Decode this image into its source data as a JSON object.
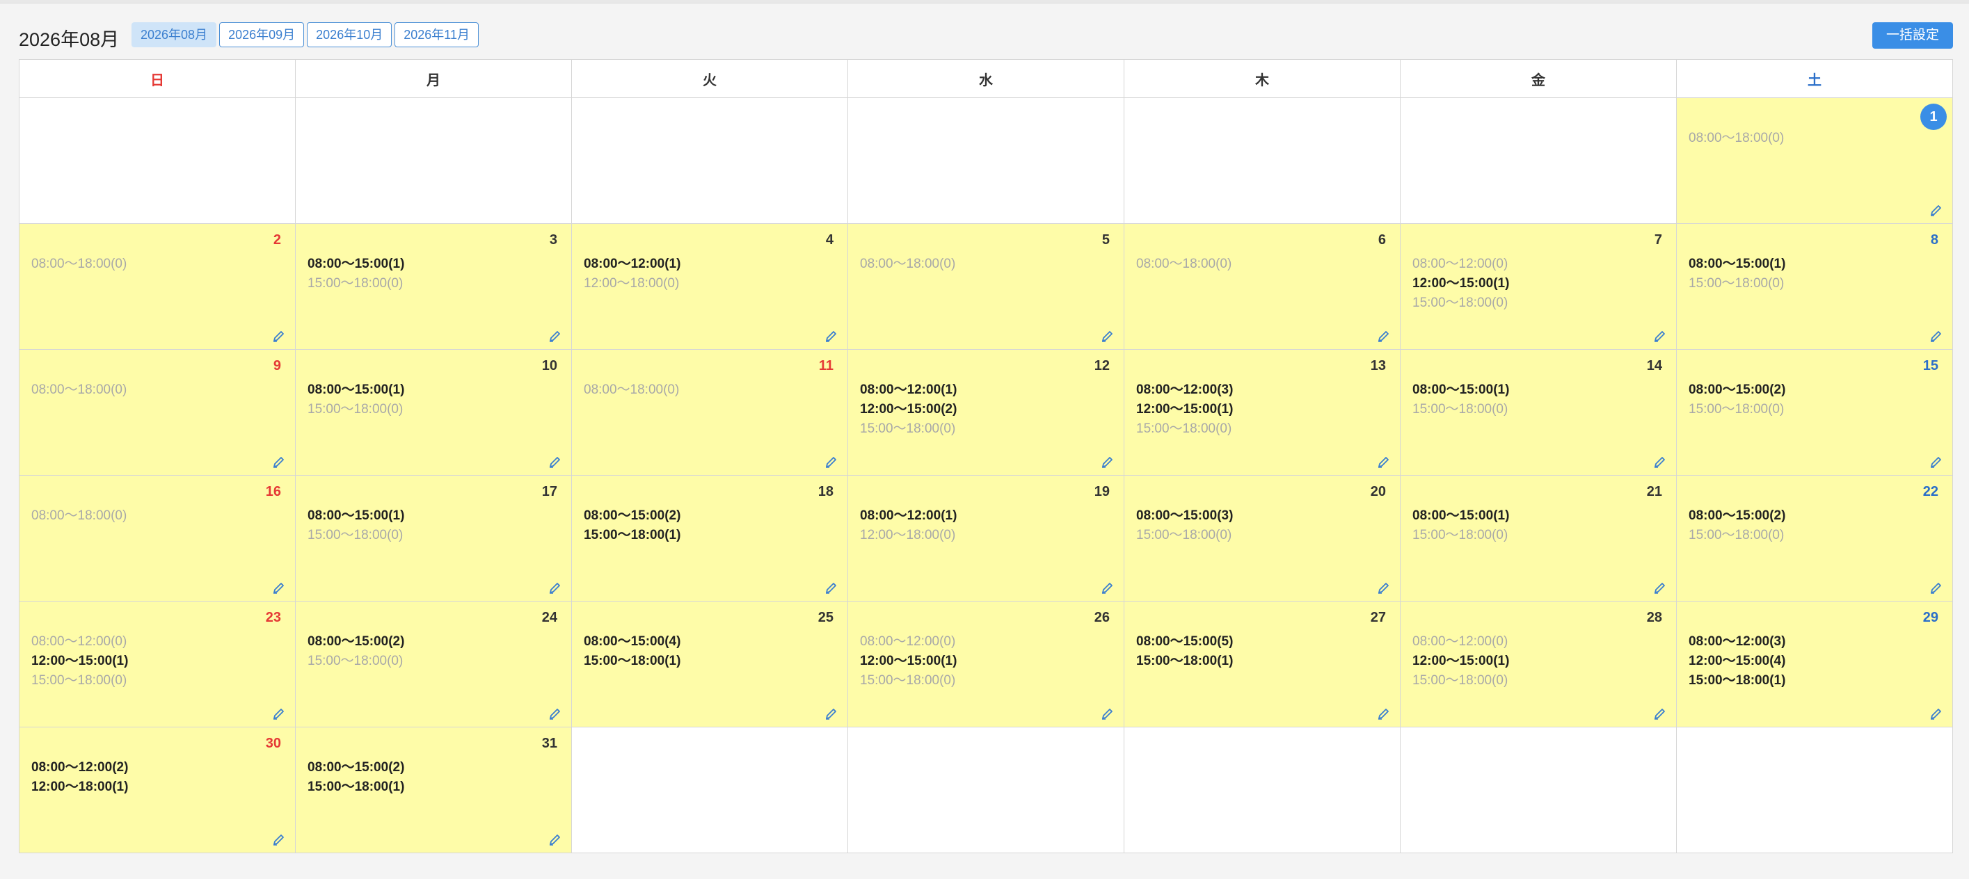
{
  "header": {
    "title": "2026年08月",
    "tabs": [
      "2026年08月",
      "2026年09月",
      "2026年10月",
      "2026年11月"
    ],
    "active_tab": 0,
    "bulk_button": "一括設定"
  },
  "weekdays": [
    "日",
    "月",
    "火",
    "水",
    "木",
    "金",
    "土"
  ],
  "colors": {
    "accent": "#3a8ee6",
    "sunday": "#e53935",
    "saturday": "#2b6fc9",
    "active_cell": "#fefca8",
    "inactive_slot": "#a8a8a8"
  },
  "cells": [
    null,
    null,
    null,
    null,
    null,
    null,
    {
      "day": "1",
      "today": true,
      "slots": [
        {
          "text": "08:00〜18:00(0)",
          "full": false
        }
      ]
    },
    {
      "day": "2",
      "slots": [
        {
          "text": "08:00〜18:00(0)",
          "full": false
        }
      ]
    },
    {
      "day": "3",
      "slots": [
        {
          "text": "08:00〜15:00(1)",
          "full": true
        },
        {
          "text": "15:00〜18:00(0)",
          "full": false
        }
      ]
    },
    {
      "day": "4",
      "slots": [
        {
          "text": "08:00〜12:00(1)",
          "full": true
        },
        {
          "text": "12:00〜18:00(0)",
          "full": false
        }
      ]
    },
    {
      "day": "5",
      "slots": [
        {
          "text": "08:00〜18:00(0)",
          "full": false
        }
      ]
    },
    {
      "day": "6",
      "slots": [
        {
          "text": "08:00〜18:00(0)",
          "full": false
        }
      ]
    },
    {
      "day": "7",
      "slots": [
        {
          "text": "08:00〜12:00(0)",
          "full": false
        },
        {
          "text": "12:00〜15:00(1)",
          "full": true
        },
        {
          "text": "15:00〜18:00(0)",
          "full": false
        }
      ]
    },
    {
      "day": "8",
      "slots": [
        {
          "text": "08:00〜15:00(1)",
          "full": true
        },
        {
          "text": "15:00〜18:00(0)",
          "full": false
        }
      ]
    },
    {
      "day": "9",
      "slots": [
        {
          "text": "08:00〜18:00(0)",
          "full": false
        }
      ]
    },
    {
      "day": "10",
      "slots": [
        {
          "text": "08:00〜15:00(1)",
          "full": true
        },
        {
          "text": "15:00〜18:00(0)",
          "full": false
        }
      ]
    },
    {
      "day": "11",
      "holiday": true,
      "slots": [
        {
          "text": "08:00〜18:00(0)",
          "full": false
        }
      ]
    },
    {
      "day": "12",
      "slots": [
        {
          "text": "08:00〜12:00(1)",
          "full": true
        },
        {
          "text": "12:00〜15:00(2)",
          "full": true
        },
        {
          "text": "15:00〜18:00(0)",
          "full": false
        }
      ]
    },
    {
      "day": "13",
      "slots": [
        {
          "text": "08:00〜12:00(3)",
          "full": true
        },
        {
          "text": "12:00〜15:00(1)",
          "full": true
        },
        {
          "text": "15:00〜18:00(0)",
          "full": false
        }
      ]
    },
    {
      "day": "14",
      "slots": [
        {
          "text": "08:00〜15:00(1)",
          "full": true
        },
        {
          "text": "15:00〜18:00(0)",
          "full": false
        }
      ]
    },
    {
      "day": "15",
      "slots": [
        {
          "text": "08:00〜15:00(2)",
          "full": true
        },
        {
          "text": "15:00〜18:00(0)",
          "full": false
        }
      ]
    },
    {
      "day": "16",
      "slots": [
        {
          "text": "08:00〜18:00(0)",
          "full": false
        }
      ]
    },
    {
      "day": "17",
      "slots": [
        {
          "text": "08:00〜15:00(1)",
          "full": true
        },
        {
          "text": "15:00〜18:00(0)",
          "full": false
        }
      ]
    },
    {
      "day": "18",
      "slots": [
        {
          "text": "08:00〜15:00(2)",
          "full": true
        },
        {
          "text": "15:00〜18:00(1)",
          "full": true
        }
      ]
    },
    {
      "day": "19",
      "slots": [
        {
          "text": "08:00〜12:00(1)",
          "full": true
        },
        {
          "text": "12:00〜18:00(0)",
          "full": false
        }
      ]
    },
    {
      "day": "20",
      "slots": [
        {
          "text": "08:00〜15:00(3)",
          "full": true
        },
        {
          "text": "15:00〜18:00(0)",
          "full": false
        }
      ]
    },
    {
      "day": "21",
      "slots": [
        {
          "text": "08:00〜15:00(1)",
          "full": true
        },
        {
          "text": "15:00〜18:00(0)",
          "full": false
        }
      ]
    },
    {
      "day": "22",
      "slots": [
        {
          "text": "08:00〜15:00(2)",
          "full": true
        },
        {
          "text": "15:00〜18:00(0)",
          "full": false
        }
      ]
    },
    {
      "day": "23",
      "slots": [
        {
          "text": "08:00〜12:00(0)",
          "full": false
        },
        {
          "text": "12:00〜15:00(1)",
          "full": true
        },
        {
          "text": "15:00〜18:00(0)",
          "full": false
        }
      ]
    },
    {
      "day": "24",
      "slots": [
        {
          "text": "08:00〜15:00(2)",
          "full": true
        },
        {
          "text": "15:00〜18:00(0)",
          "full": false
        }
      ]
    },
    {
      "day": "25",
      "slots": [
        {
          "text": "08:00〜15:00(4)",
          "full": true
        },
        {
          "text": "15:00〜18:00(1)",
          "full": true
        }
      ]
    },
    {
      "day": "26",
      "slots": [
        {
          "text": "08:00〜12:00(0)",
          "full": false
        },
        {
          "text": "12:00〜15:00(1)",
          "full": true
        },
        {
          "text": "15:00〜18:00(0)",
          "full": false
        }
      ]
    },
    {
      "day": "27",
      "slots": [
        {
          "text": "08:00〜15:00(5)",
          "full": true
        },
        {
          "text": "15:00〜18:00(1)",
          "full": true
        }
      ]
    },
    {
      "day": "28",
      "slots": [
        {
          "text": "08:00〜12:00(0)",
          "full": false
        },
        {
          "text": "12:00〜15:00(1)",
          "full": true
        },
        {
          "text": "15:00〜18:00(0)",
          "full": false
        }
      ]
    },
    {
      "day": "29",
      "slots": [
        {
          "text": "08:00〜12:00(3)",
          "full": true
        },
        {
          "text": "12:00〜15:00(4)",
          "full": true
        },
        {
          "text": "15:00〜18:00(1)",
          "full": true
        }
      ]
    },
    {
      "day": "30",
      "slots": [
        {
          "text": "08:00〜12:00(2)",
          "full": true
        },
        {
          "text": "12:00〜18:00(1)",
          "full": true
        }
      ]
    },
    {
      "day": "31",
      "slots": [
        {
          "text": "08:00〜15:00(2)",
          "full": true
        },
        {
          "text": "15:00〜18:00(1)",
          "full": true
        }
      ]
    },
    null,
    null,
    null,
    null,
    null
  ]
}
